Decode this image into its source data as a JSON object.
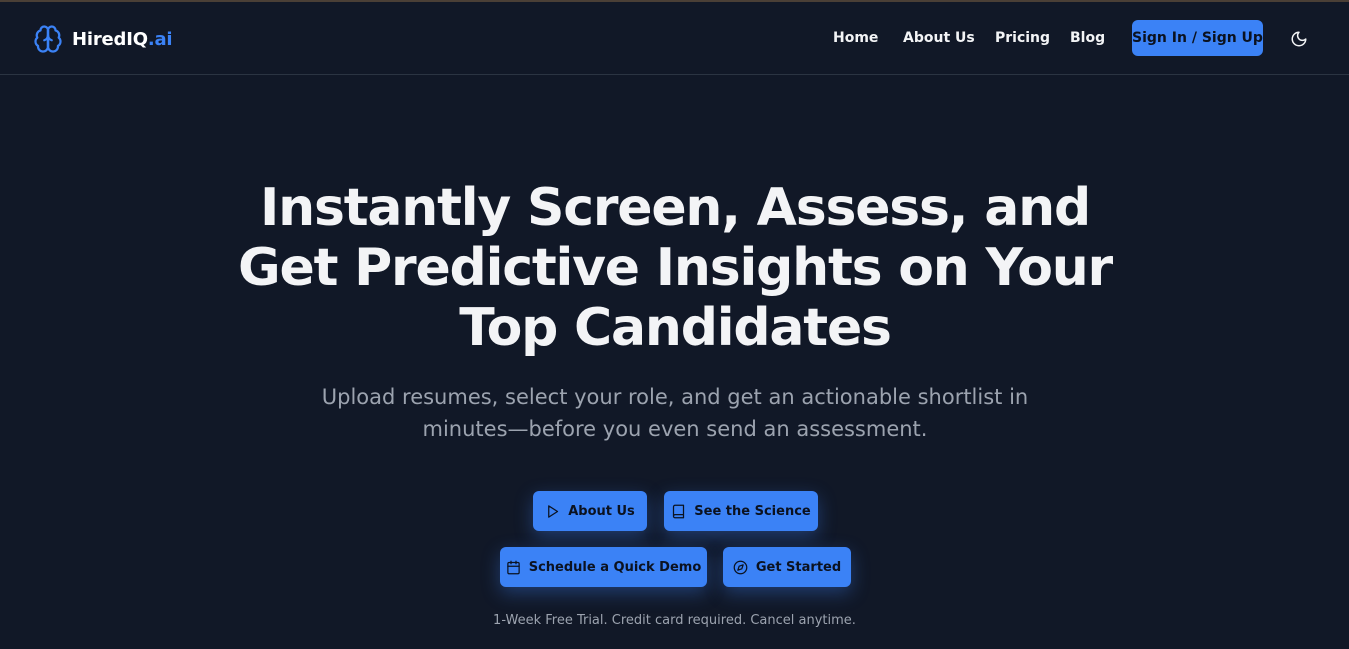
{
  "brand": {
    "name": "HiredIQ",
    "suffix": ".ai"
  },
  "nav": {
    "items": [
      "Home",
      "About Us",
      "Pricing",
      "Blog"
    ],
    "signin_label": "Sign In / Sign Up",
    "theme_icon": "moon-icon"
  },
  "hero": {
    "title": "Instantly Screen, Assess, and Get Predictive Insights on Your Top Candidates",
    "subtitle": "Upload resumes, select your role, and get an actionable shortlist in minutes—before you even send an assessment."
  },
  "buttons": {
    "about": {
      "label": "About Us",
      "icon": "play-icon"
    },
    "science": {
      "label": "See the Science",
      "icon": "book-icon"
    },
    "demo": {
      "label": "Schedule a Quick Demo",
      "icon": "calendar-icon"
    },
    "started": {
      "label": "Get Started",
      "icon": "compass-icon"
    }
  },
  "note": "1-Week Free Trial. Credit card required. Cancel anytime.",
  "colors": {
    "background": "#111827",
    "accent": "#3b82f6",
    "muted": "#9ca3af"
  }
}
